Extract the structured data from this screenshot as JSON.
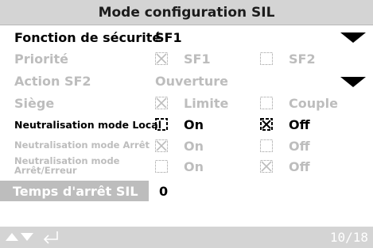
{
  "title": "Mode configuration SIL",
  "fonction": {
    "label": "Fonction de sécurité",
    "value": "SF1"
  },
  "priorite": {
    "label": "Priorité",
    "opt1": "SF1",
    "opt2": "SF2"
  },
  "action": {
    "label": "Action SF2",
    "value": "Ouverture"
  },
  "siege": {
    "label": "Siège",
    "opt1": "Limite",
    "opt2": "Couple"
  },
  "local": {
    "label": "Neutralisation mode Local",
    "opt1": "On",
    "opt2": "Off"
  },
  "arret": {
    "label": "Neutralisation mode Arrêt",
    "opt1": "On",
    "opt2": "Off"
  },
  "arret_erreur": {
    "label_line1": "Neutralisation mode",
    "label_line2": "Arrêt/Erreur",
    "opt1": "On",
    "opt2": "Off"
  },
  "temps": {
    "label": "Temps d'arrêt SIL",
    "value": "0"
  },
  "footer": {
    "page": "10/18"
  },
  "colors": {
    "header_bg": "#d4d4d4",
    "disabled_text": "#bdbdbd",
    "highlight_bg": "#bdbdbd",
    "text": "#000000"
  },
  "icons": [
    "checkbox-checked-icon",
    "checkbox-unchecked-icon",
    "dropdown-arrow-icon",
    "up-arrow-icon",
    "down-arrow-icon",
    "enter-icon"
  ]
}
